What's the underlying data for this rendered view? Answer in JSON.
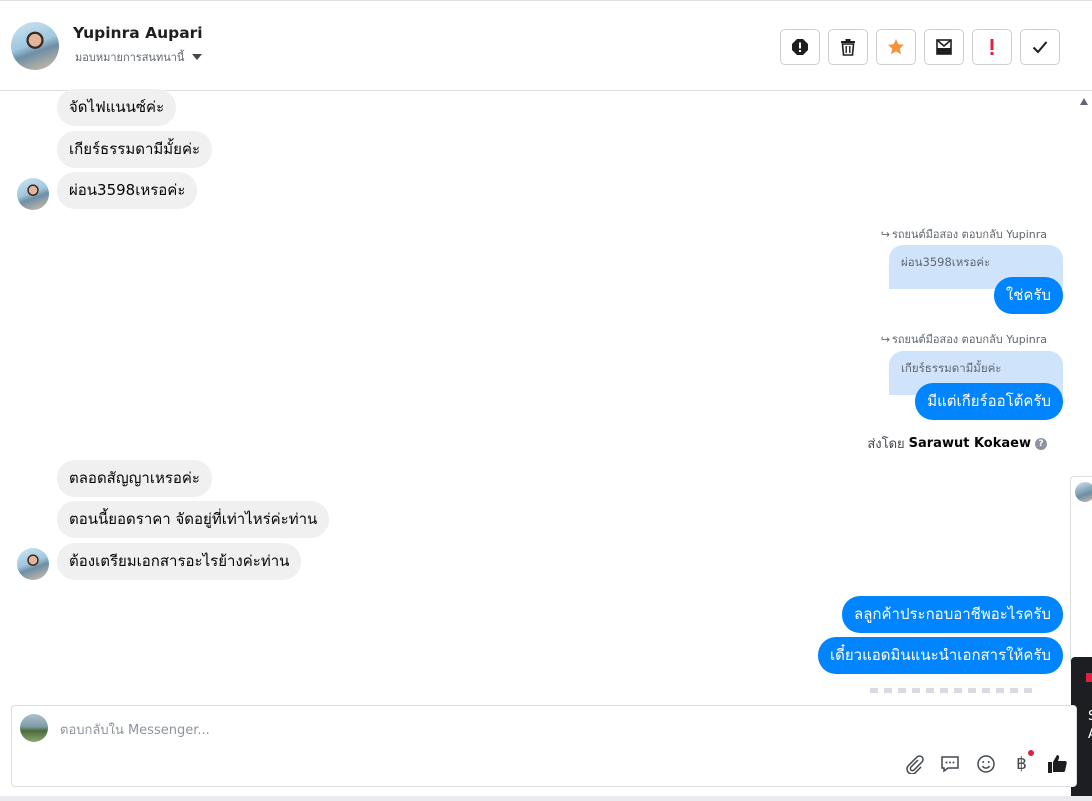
{
  "header": {
    "contact_name": "Yupinra Aupari",
    "assign_label": "มอบหมายการสนทนานี้",
    "actions": [
      {
        "name": "spam-icon",
        "color": "#1c1e21"
      },
      {
        "name": "trash-icon",
        "color": "#1c1e21"
      },
      {
        "name": "star-icon",
        "color": "#f7923b"
      },
      {
        "name": "archive-icon",
        "color": "#1c1e21"
      },
      {
        "name": "important-icon",
        "color": "#e41e3f"
      },
      {
        "name": "check-icon",
        "color": "#1c1e21"
      }
    ]
  },
  "messages": {
    "incoming_1": "จัดไฟแนนซ์ค่ะ",
    "incoming_2": "เกียร์ธรรมดามีมั้ยค่ะ",
    "incoming_3": "ผ่อน3598เหรอค่ะ",
    "reply_meta_1": "รถยนต์มือสอง ตอบกลับ Yupinra",
    "quote_1": "ผ่อน3598เหรอค่ะ",
    "outgoing_1": "ใช่ครับ",
    "reply_meta_2": "รถยนต์มือสอง ตอบกลับ Yupinra",
    "quote_2": "เกียร์ธรรมดามีมั้ยค่ะ",
    "outgoing_2": "มีแต่เกียร์ออโต้ครับ",
    "sent_by_prefix": "ส่งโดย",
    "sent_by_name": "Sarawut Kokaew",
    "incoming_4": "ตลอดสัญญาเหรอค่ะ",
    "incoming_5": "ตอนนี้ยอดราคา จัดอยู่ที่เท่าไหร่ค่ะท่าน",
    "incoming_6": "ต้องเตรียมเอกสารอะไรย้างค่ะท่าน",
    "outgoing_3": "ลลูกค้าประกอบอาชีพอะไรครับ",
    "outgoing_4": "เดี๋ยวแอดมินแนะนำเอกสารให้ครับ"
  },
  "side_panel": {
    "line1": "S",
    "line2": "A"
  },
  "composer": {
    "placeholder": "ตอบกลับใน Messenger..."
  },
  "colors": {
    "outgoing_bubble": "#0084ff",
    "incoming_bubble": "#f0f0f0",
    "quote_bubble": "#cfe4fb",
    "like": "#1c1e21"
  }
}
